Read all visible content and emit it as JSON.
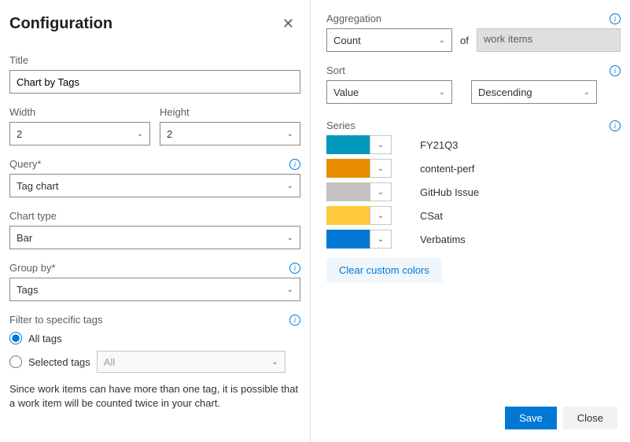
{
  "header": {
    "title": "Configuration"
  },
  "left": {
    "titleLabel": "Title",
    "titleValue": "Chart by Tags",
    "widthLabel": "Width",
    "widthValue": "2",
    "heightLabel": "Height",
    "heightValue": "2",
    "queryLabel": "Query*",
    "queryValue": "Tag chart",
    "chartTypeLabel": "Chart type",
    "chartTypeValue": "Bar",
    "groupByLabel": "Group by*",
    "groupByValue": "Tags",
    "filterLabel": "Filter to specific tags",
    "allTagsLabel": "All tags",
    "selectedTagsLabel": "Selected tags",
    "selectedTagsValue": "All",
    "note": "Since work items can have more than one tag, it is possible that a work item will be counted twice in your chart."
  },
  "right": {
    "aggregationLabel": "Aggregation",
    "aggregationValue": "Count",
    "ofLabel": "of",
    "aggregationTarget": "work items",
    "sortLabel": "Sort",
    "sortByValue": "Value",
    "sortDirValue": "Descending",
    "seriesLabel": "Series",
    "series": [
      {
        "color": "#0099bc",
        "label": "FY21Q3"
      },
      {
        "color": "#e88c00",
        "label": "content-perf"
      },
      {
        "color": "#c2c2c2",
        "label": "GitHub Issue"
      },
      {
        "color": "#ffc83d",
        "label": "CSat"
      },
      {
        "color": "#0078d4",
        "label": "Verbatims"
      }
    ],
    "clearColorsLabel": "Clear custom colors"
  },
  "footer": {
    "save": "Save",
    "close": "Close"
  }
}
